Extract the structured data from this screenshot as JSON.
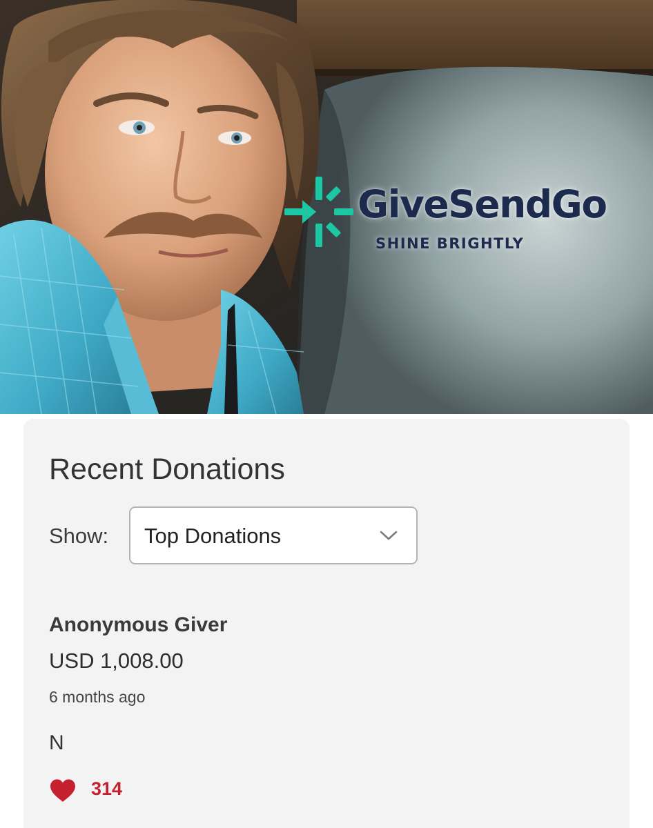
{
  "hero": {
    "logo": {
      "wordmark": "GiveSendGo",
      "tagline": "SHINE BRIGHTLY",
      "mark_icon": "givesendgo-burst-icon"
    },
    "colors": {
      "logo_teal": "#1ec7a4",
      "logo_navy": "#1b2a4d"
    }
  },
  "donations": {
    "title": "Recent Donations",
    "show_label": "Show:",
    "filter": {
      "selected": "Top Donations",
      "icon": "chevron-down-icon"
    },
    "items": [
      {
        "donor": "Anonymous Giver",
        "amount": "USD 1,008.00",
        "time": "6 months ago",
        "message": "N",
        "likes": "314",
        "like_icon": "heart-icon"
      }
    ]
  },
  "colors": {
    "card_background": "#f3f3f4",
    "like_red": "#c5202e",
    "select_border": "#b3b4ba"
  }
}
